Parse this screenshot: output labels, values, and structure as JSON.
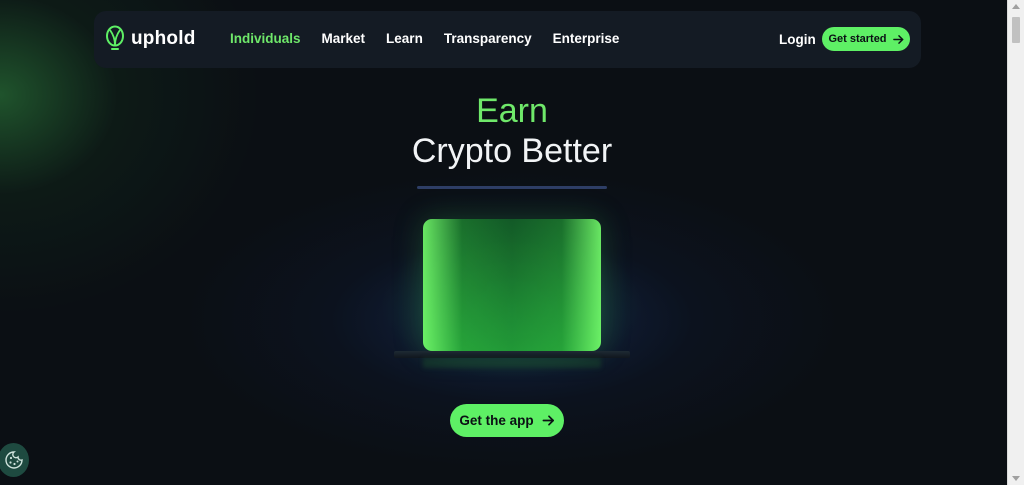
{
  "brand": {
    "name": "uphold",
    "logo_icon": "uphold-logo-icon",
    "accent_color": "#5ef065"
  },
  "nav": {
    "links": [
      {
        "label": "Individuals",
        "active": true
      },
      {
        "label": "Market",
        "active": false
      },
      {
        "label": "Learn",
        "active": false
      },
      {
        "label": "Transparency",
        "active": false
      },
      {
        "label": "Enterprise",
        "active": false
      }
    ],
    "login_label": "Login",
    "cta_label": "Get started",
    "cta_icon": "arrow-right-icon"
  },
  "hero": {
    "line1": "Earn",
    "line2": "Crypto Better",
    "cta_label": "Get the app",
    "cta_icon": "arrow-right-icon"
  },
  "cookie": {
    "icon": "cookie-icon"
  }
}
